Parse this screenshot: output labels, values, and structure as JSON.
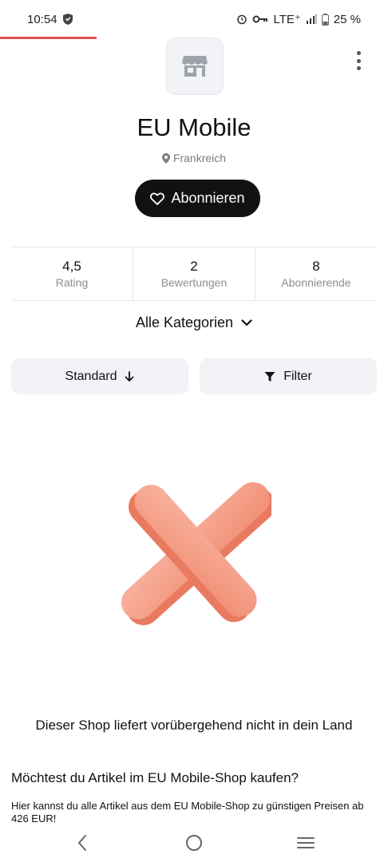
{
  "status_bar": {
    "time": "10:54",
    "network": "LTE⁺",
    "battery": "25 %"
  },
  "shop": {
    "name": "EU Mobile",
    "location": "Frankreich",
    "subscribe_label": "Abonnieren"
  },
  "stats": [
    {
      "value": "4,5",
      "label": "Rating"
    },
    {
      "value": "2",
      "label": "Bewertungen"
    },
    {
      "value": "8",
      "label": "Abonnierende"
    }
  ],
  "categories_label": "Alle Kategorien",
  "sort_label": "Standard",
  "filter_label": "Filter",
  "empty_message": "Dieser Shop liefert vorübergehend nicht in dein Land",
  "promo": {
    "title": "Möchtest du Artikel im EU Mobile-Shop kaufen?",
    "text": "Hier kannst du alle Artikel aus dem EU Mobile-Shop zu günstigen Preisen ab 426 EUR!"
  },
  "colors": {
    "accent_line": "#d9534f",
    "illustration": "#f4937a"
  }
}
